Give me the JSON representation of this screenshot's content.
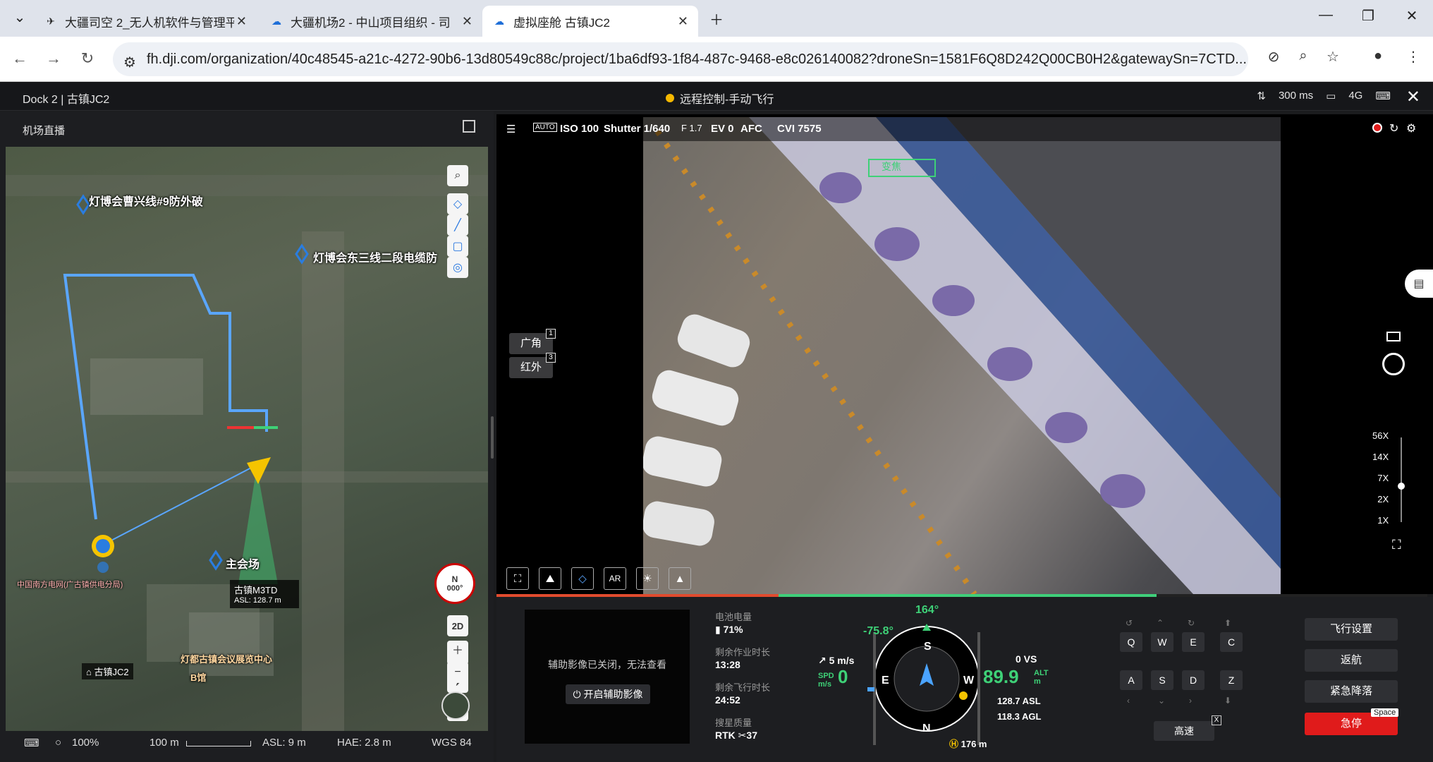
{
  "browser": {
    "tabs": [
      {
        "label": "大疆司空 2_无人机软件与管理平"
      },
      {
        "label": "大疆机场2 - 中山项目组织 - 司"
      },
      {
        "label": "虚拟座舱 古镇JC2"
      }
    ],
    "url": "fh.dji.com/organization/40c48545-a21c-4272-90b6-13d80549c88c/project/1ba6df93-1f84-487c-9468-e8c026140082?droneSn=1581F6Q8D242Q00CB0H2&gatewaySn=7CTD..."
  },
  "app": {
    "title": "Dock 2 | 古镇JC2",
    "status": "远程控制-手动飞行",
    "latency": "300 ms",
    "signal": "4G"
  },
  "left_panel": {
    "title": "机场直播",
    "map_labels": {
      "label1": "灯博会曹兴线#9防外破",
      "label2": "灯博会东三线二段电缆防",
      "label3": "主会场",
      "label4": "灯都古镇会议展览中心",
      "label5": "B馆",
      "label6": "中国南方电网(广古镇供电分局)"
    },
    "drone_tag": {
      "name": "古镇M3TD",
      "asl": "ASL: 128.7 m"
    },
    "dock_tag": "古镇JC2",
    "compass": {
      "dir": "N",
      "deg": "000°"
    },
    "map_mode": "2D",
    "footer": {
      "zoom": "100%",
      "scale": "100 m",
      "asl": "ASL: 9 m",
      "hae": "HAE: 2.8 m",
      "datum": "WGS 84"
    }
  },
  "video": {
    "toolbar": {
      "mode": "AUTO",
      "iso": "ISO 100",
      "shutter": "Shutter 1/640",
      "fnum": "F 1.7",
      "ev": "EV 0",
      "af": "AFC",
      "cvi": "CVI 7575"
    },
    "lens": [
      {
        "label": "广角",
        "num": "1"
      },
      {
        "label": "红外",
        "num": "3"
      }
    ],
    "zoom_levels": [
      "56X",
      "14X",
      "7X",
      "2X",
      "1X"
    ],
    "feed_overlay": "变焦"
  },
  "telemetry": {
    "aux_msg": "辅助影像已关闭，无法查看",
    "aux_btn": "开启辅助影像",
    "battery_label": "电池电量",
    "battery": "71%",
    "remaining_work_label": "剩余作业时长",
    "remaining_work": "13:28",
    "remaining_flight_label": "剩余飞行时长",
    "remaining_flight": "24:52",
    "search_label": "搜星质量",
    "rtk": "RTK",
    "rtk_count": "37",
    "heading": "164°",
    "gimbal_pitch": "-75.8°",
    "wind": "5 m/s",
    "spd_label": "SPD",
    "spd_unit": "m/s",
    "spd_value": "0",
    "vs": "0 VS",
    "alt_value": "89.9",
    "alt_label": "ALT",
    "alt_unit": "m",
    "asl": "128.7 ASL",
    "agl": "118.3 AGL",
    "home_dist": "176 m"
  },
  "controls": {
    "keys_row1": [
      "Q",
      "W",
      "E",
      "C"
    ],
    "keys_row2": [
      "A",
      "S",
      "D",
      "Z"
    ],
    "speed": "高速",
    "speed_key": "X",
    "flight_settings": "飞行设置",
    "rth": "返航",
    "emergency_land": "紧急降落",
    "emergency_stop": "急停",
    "space": "Space"
  }
}
